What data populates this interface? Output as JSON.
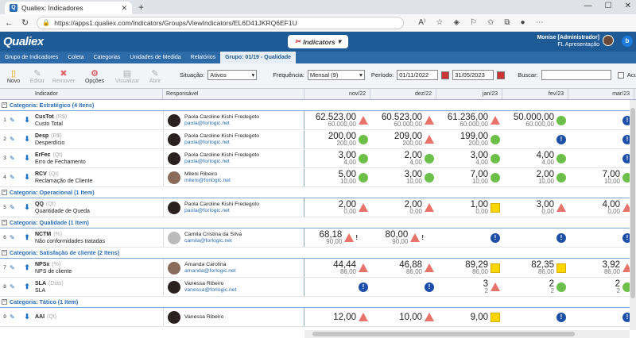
{
  "browser": {
    "tab_title": "Qualiex: Indicadores",
    "url": "https://apps1.qualiex.com/Indicators/Groups/ViewIndicators/EL6D41JKRQ6EF1U"
  },
  "app": {
    "logo": "Qualiex",
    "module": "Indicators",
    "user_name": "Monise [Administrador]",
    "user_company": "FL Apresentação"
  },
  "menu": [
    "Grupo de Indicadores",
    "Coleta",
    "Categorias",
    "Unidades de Medida",
    "Relatórios",
    "Grupo: 01/19 - Qualidade"
  ],
  "toolbar": {
    "novo": "Novo",
    "editar": "Editar",
    "remover": "Remover",
    "opcoes": "Opções",
    "visualizar": "Visualizar",
    "abrir": "Abrir"
  },
  "filters": {
    "status_label": "Situação:",
    "status_value": "Ativos",
    "freq_label": "Frequência:",
    "freq_value": "Mensal (9)",
    "period_label": "Período:",
    "date_from": "01/11/2022",
    "date_to": "31/05/2023",
    "search_label": "Buscar:",
    "accum_label": "Acumular"
  },
  "columns": {
    "indicador": "Indicador",
    "responsavel": "Responsável",
    "months": [
      "nov/22",
      "dez/22",
      "jan/23",
      "fev/23",
      "mar/23"
    ]
  },
  "sections": [
    {
      "title": "Categoria: Estratégico (4 Itens)",
      "rows": [
        {
          "n": "1",
          "code": "CusTot",
          "unit": "(R$)",
          "desc": "Custo Total",
          "arrow": "down",
          "name": "Paola Caroline Kishi Fredegoto",
          "mail": "paola@forlogic.net",
          "av": "dark",
          "cells": [
            {
              "v": "62.523,00",
              "m": "60.000,00",
              "i": "red"
            },
            {
              "v": "60.523,00",
              "m": "60.000,00",
              "i": "red"
            },
            {
              "v": "61.236,00",
              "m": "60.000,00",
              "i": "red"
            },
            {
              "v": "50.000,00",
              "m": "60.000,00",
              "i": "green"
            },
            {
              "v": "",
              "m": "",
              "i": "blue"
            }
          ]
        },
        {
          "n": "2",
          "code": "Desp",
          "unit": "(R$)",
          "desc": "Desperdício",
          "arrow": "down",
          "name": "Paola Caroline Kishi Fredegoto",
          "mail": "paola@forlogic.net",
          "av": "dark",
          "cells": [
            {
              "v": "200,00",
              "m": "200,00",
              "i": "green"
            },
            {
              "v": "209,00",
              "m": "200,00",
              "i": "red"
            },
            {
              "v": "199,00",
              "m": "200,00",
              "i": "green"
            },
            {
              "v": "",
              "m": "",
              "i": "blue"
            },
            {
              "v": "",
              "m": "",
              "i": "blue"
            }
          ]
        },
        {
          "n": "3",
          "code": "ErFec",
          "unit": "(Qt)",
          "desc": "Erro de Fechamento",
          "arrow": "down",
          "name": "Paola Caroline Kishi Fredegoto",
          "mail": "paola@forlogic.net",
          "av": "dark",
          "cells": [
            {
              "v": "3,00",
              "m": "4,00",
              "i": "green"
            },
            {
              "v": "2,00",
              "m": "4,00",
              "i": "green"
            },
            {
              "v": "3,00",
              "m": "4,00",
              "i": "green"
            },
            {
              "v": "4,00",
              "m": "4,00",
              "i": "green"
            },
            {
              "v": "",
              "m": "",
              "i": "blue"
            }
          ]
        },
        {
          "n": "4",
          "code": "RCV",
          "unit": "(Qt)",
          "desc": "Reclamação de Cliente",
          "arrow": "down",
          "name": "Mileni Ribeiro",
          "mail": "mileni@forlogic.net",
          "av": "light",
          "cells": [
            {
              "v": "5,00",
              "m": "10,00",
              "i": "green"
            },
            {
              "v": "3,00",
              "m": "10,00",
              "i": "green"
            },
            {
              "v": "7,00",
              "m": "10,00",
              "i": "green"
            },
            {
              "v": "2,00",
              "m": "10,00",
              "i": "green"
            },
            {
              "v": "7,00",
              "m": "10,00",
              "i": "green"
            }
          ]
        }
      ]
    },
    {
      "title": "Categoria: Operacional (1 Item)",
      "rows": [
        {
          "n": "5",
          "code": "QQ",
          "unit": "(Qt)",
          "desc": "Quantidade de Queda",
          "arrow": "down",
          "name": "Paola Caroline Kishi Fredegoto",
          "mail": "paola@forlogic.net",
          "av": "dark",
          "cells": [
            {
              "v": "2,00",
              "m": "0,00",
              "i": "red"
            },
            {
              "v": "2,00",
              "m": "0,00",
              "i": "red"
            },
            {
              "v": "1,00",
              "m": "0,00",
              "i": "yellow"
            },
            {
              "v": "3,00",
              "m": "0,00",
              "i": "red"
            },
            {
              "v": "4,00",
              "m": "0,00",
              "i": "red"
            }
          ]
        }
      ]
    },
    {
      "title": "Categoria: Qualidade (1 Item)",
      "rows": [
        {
          "n": "6",
          "code": "NCTM",
          "unit": "(%)",
          "desc": "Não conformidades tratadas",
          "arrow": "up",
          "name": "Camila Cristina da Silva",
          "mail": "camila@forlogic.net",
          "av": "gray",
          "cells": [
            {
              "v": "68,18",
              "m": "90,00",
              "i": "red",
              "x": "!"
            },
            {
              "v": "80,00",
              "m": "90,00",
              "i": "red",
              "x": "!"
            },
            {
              "v": "",
              "m": "",
              "i": "blue"
            },
            {
              "v": "",
              "m": "",
              "i": "blue"
            },
            {
              "v": "",
              "m": "",
              "i": "blue"
            }
          ]
        }
      ]
    },
    {
      "title": "Categoria: Satisfação de cliente (2 Itens)",
      "rows": [
        {
          "n": "7",
          "code": "NPSx",
          "unit": "(%)",
          "desc": "NPS de cliente",
          "arrow": "up",
          "name": "Amanda Carolina",
          "mail": "amanda@forlogic.net",
          "av": "light",
          "cells": [
            {
              "v": "44,44",
              "m": "86,00",
              "i": "red"
            },
            {
              "v": "46,88",
              "m": "86,00",
              "i": "red"
            },
            {
              "v": "89,29",
              "m": "86,00",
              "i": "yellow"
            },
            {
              "v": "82,35",
              "m": "86,00",
              "i": "yellow"
            },
            {
              "v": "3,92",
              "m": "86,00",
              "i": "red"
            }
          ]
        },
        {
          "n": "8",
          "code": "SLA",
          "unit": "(Dias)",
          "desc": "SLA",
          "arrow": "up",
          "name": "Vanessa Ribeiro",
          "mail": "vanessa@forlogic.net",
          "av": "dark",
          "cells": [
            {
              "v": "",
              "m": "",
              "i": "blue"
            },
            {
              "v": "",
              "m": "",
              "i": "blue"
            },
            {
              "v": "3",
              "m": "2",
              "i": "red"
            },
            {
              "v": "2",
              "m": "2",
              "i": "green"
            },
            {
              "v": "2",
              "m": "2",
              "i": "green"
            }
          ]
        }
      ]
    },
    {
      "title": "Categoria: Tático (1 Item)",
      "rows": [
        {
          "n": "9",
          "code": "AAI",
          "unit": "(Qt)",
          "desc": "",
          "arrow": "down",
          "name": "Vanessa Ribeiro",
          "mail": "",
          "av": "dark",
          "cells": [
            {
              "v": "12,00",
              "m": "",
              "i": "red"
            },
            {
              "v": "10,00",
              "m": "",
              "i": "red"
            },
            {
              "v": "9,00",
              "m": "",
              "i": "yellow"
            },
            {
              "v": "",
              "m": "",
              "i": "blue"
            },
            {
              "v": "",
              "m": "",
              "i": "blue"
            }
          ]
        }
      ]
    }
  ]
}
